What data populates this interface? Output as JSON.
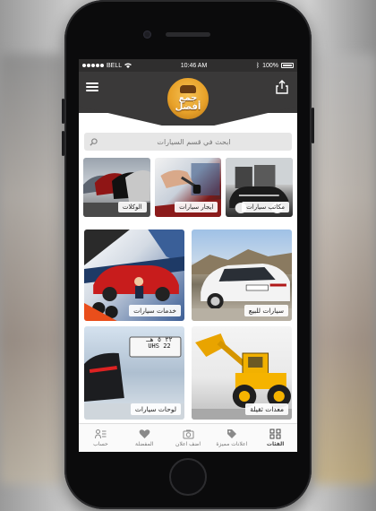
{
  "status_bar": {
    "carrier": "BELL",
    "time": "10:46 AM",
    "battery": "100%",
    "battery_level": 1.0
  },
  "header": {
    "logo_text": "جمع أفضل"
  },
  "search": {
    "placeholder": "ابحث في قسم السيارات"
  },
  "top_categories": [
    {
      "label": "مكاتب سيارات",
      "icon": "car-showroom-photo"
    },
    {
      "label": "ايجار سيارات",
      "icon": "car-keys-photo"
    },
    {
      "label": "الوكلات",
      "icon": "dealership-cars-photo"
    }
  ],
  "grid_categories": [
    {
      "label": "سيارات للبيع",
      "icon": "white-audi-photo"
    },
    {
      "label": "خدمات سيارات",
      "icon": "car-service-photo"
    },
    {
      "label": "معدات ثقيلة",
      "icon": "yellow-loader-photo"
    },
    {
      "label": "لوحات سيارات",
      "icon": "license-plate-photo"
    }
  ],
  "plate": {
    "line1": "٢٢ ٥ هـ",
    "line2": "22 UHS"
  },
  "tabbar": [
    {
      "label": "الفئات",
      "icon": "grid-icon",
      "active": true
    },
    {
      "label": "اعلانات مميزة",
      "icon": "tag-icon",
      "active": false
    },
    {
      "label": "اضف اعلان",
      "icon": "camera-icon",
      "active": false
    },
    {
      "label": "المفضلة",
      "icon": "heart-icon",
      "active": false
    },
    {
      "label": "حساب",
      "icon": "account-icon",
      "active": false
    }
  ],
  "colors": {
    "header": "#3a3939",
    "logo": "#e8a22a",
    "tab_inactive": "#777777"
  }
}
